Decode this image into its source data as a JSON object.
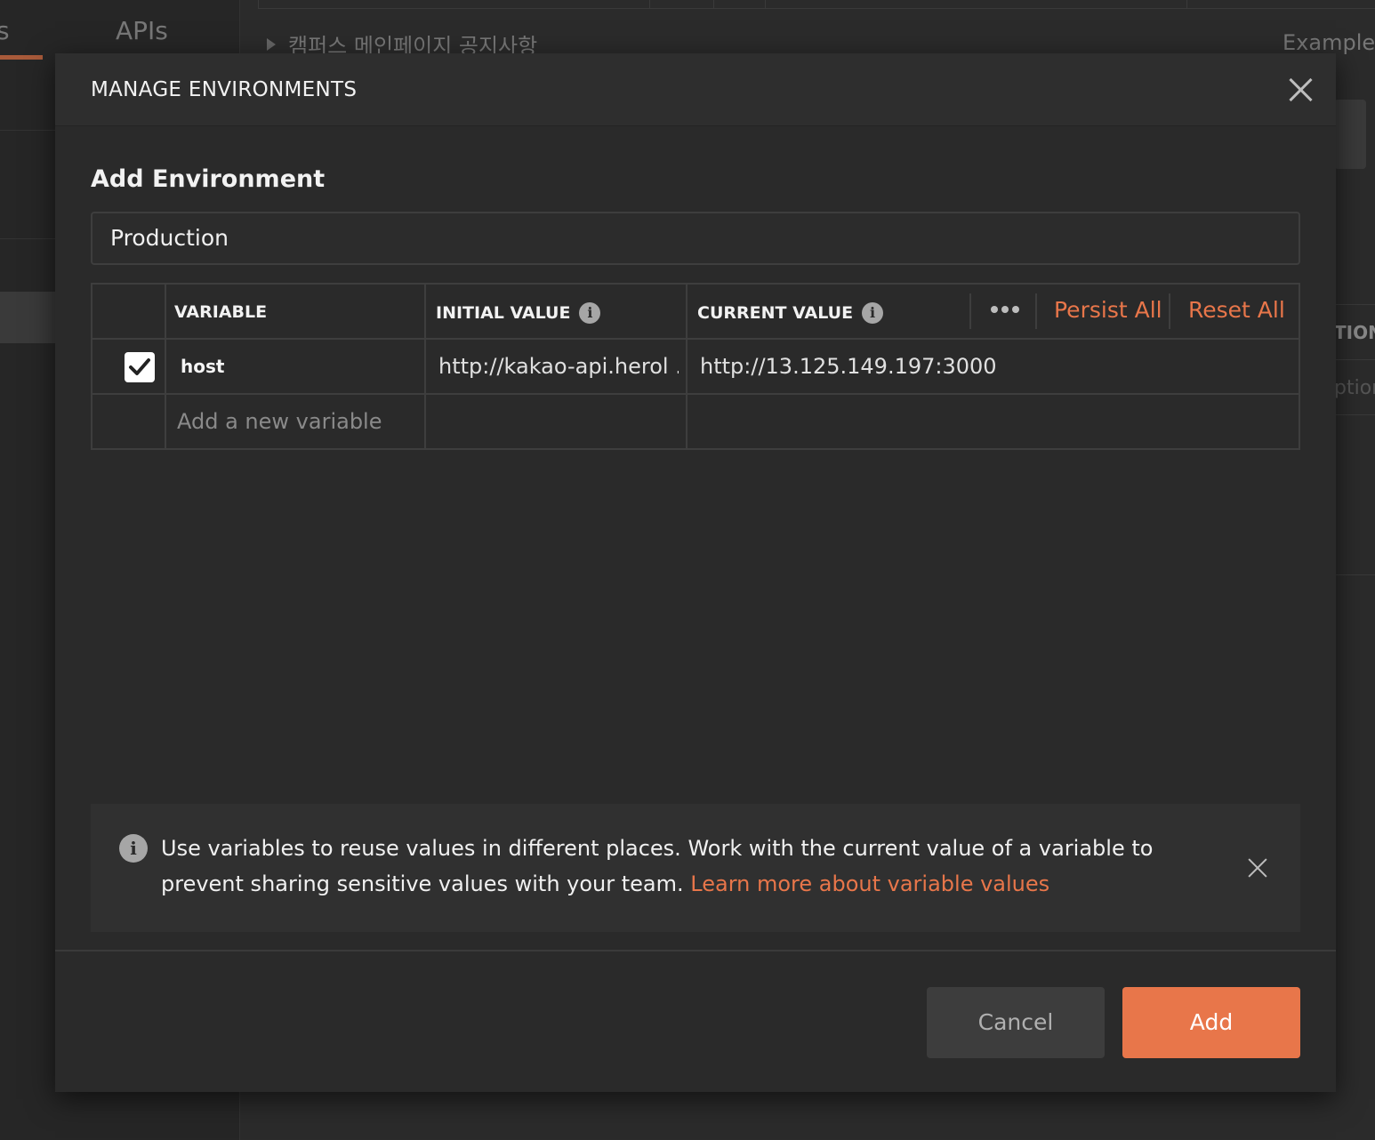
{
  "background": {
    "sidebar_tab_partial": "s",
    "sidebar_tab_apis": "APIs",
    "request_title": "캠퍼스 메인페이지 공지사항",
    "examples_label": "Examples",
    "right_column_header_partial": "TION",
    "right_column_placeholder_partial": "ption"
  },
  "modal": {
    "title": "MANAGE ENVIRONMENTS",
    "section_title": "Add Environment",
    "environment_name": "Production",
    "table": {
      "headers": {
        "variable": "VARIABLE",
        "initial_value": "INITIAL VALUE",
        "current_value": "CURRENT VALUE"
      },
      "persist_all": "Persist All",
      "reset_all": "Reset All",
      "rows": [
        {
          "enabled": true,
          "variable": "host",
          "initial_value": "http://kakao-api.herol ...",
          "current_value": "http://13.125.149.197:3000"
        }
      ],
      "new_variable_placeholder": "Add a new variable"
    },
    "banner": {
      "text": "Use variables to reuse values in different places. Work with the current value of a variable to prevent sharing sensitive values with your team. ",
      "link": "Learn more about variable values"
    },
    "buttons": {
      "cancel": "Cancel",
      "add": "Add"
    }
  },
  "colors": {
    "accent": "#e8764a",
    "background": "#222222",
    "modal": "#2a2a2a"
  },
  "icons": [
    "close-icon",
    "info-icon",
    "checkmark-icon",
    "more-options-icon",
    "caret-right-icon"
  ]
}
